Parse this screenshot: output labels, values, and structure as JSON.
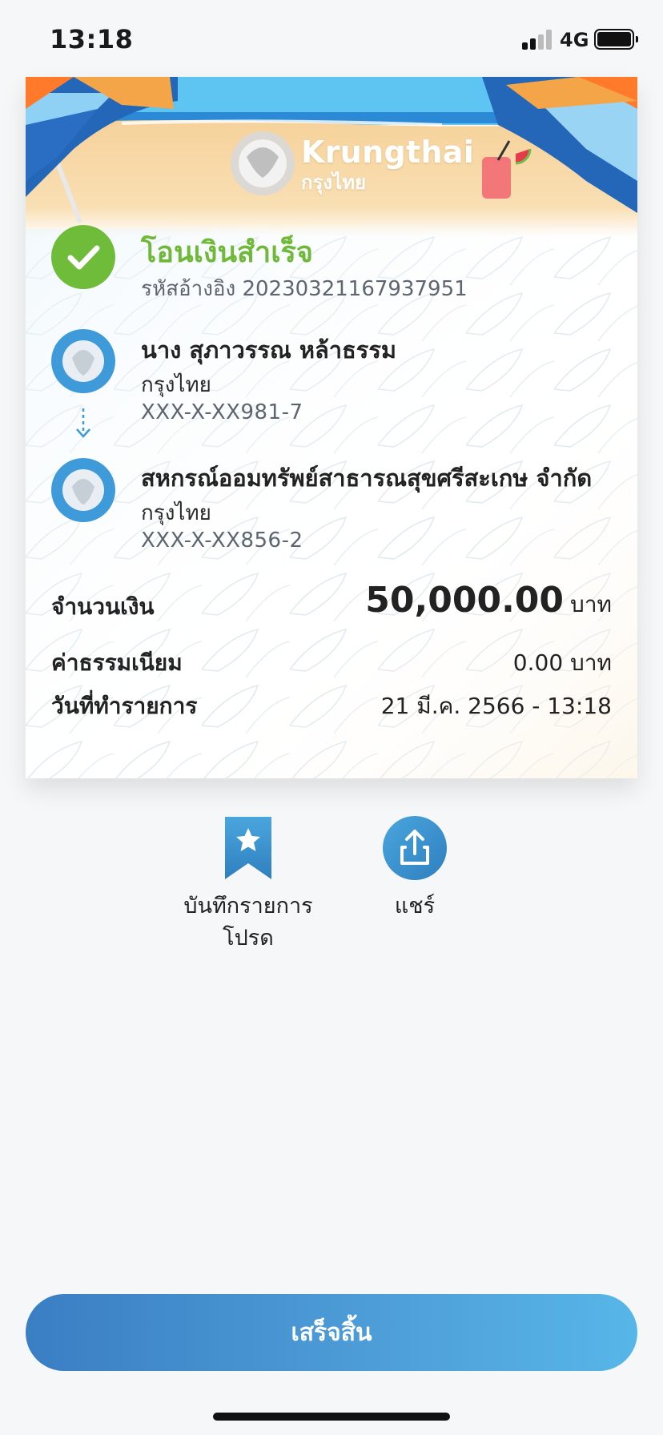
{
  "status_bar": {
    "time": "13:18",
    "network": "4G"
  },
  "receipt": {
    "logo_en": "Krungthai",
    "logo_th": "กรุงไทย",
    "status_title": "โอนเงินสำเร็จ",
    "reference": "รหัสอ้างอิง 2023032116793795‌1",
    "sender": {
      "name": "นาง สุภาวรรณ หล้าธรรม",
      "bank": "กรุงไทย",
      "account": "XXX-X-XX981-7"
    },
    "receiver": {
      "name": "สหกรณ์ออมทรัพย์สาธารณสุขศรีสะเกษ จำกัด",
      "bank": "กรุงไทย",
      "account": "XXX-X-XX856-2"
    },
    "amount_label": "จำนวนเงิน",
    "amount_value": "50,000.00",
    "amount_unit": "บาท",
    "fee_label": "ค่าธรรมเนียม",
    "fee_value": "0.00 บาท",
    "date_label": "วันที่ทำรายการ",
    "date_value": "21 มี.ค. 2566 - 13:18"
  },
  "actions": {
    "favorite_line1": "บันทึกรายการ",
    "favorite_line2": "โปรด",
    "share_label": "แชร์"
  },
  "done_label": "เสร็จสิ้น",
  "colors": {
    "success_green": "#70b938",
    "brand_blue": "#3e9ad8",
    "button_gradient_start": "#3a7ec3",
    "button_gradient_end": "#57b6e8"
  }
}
